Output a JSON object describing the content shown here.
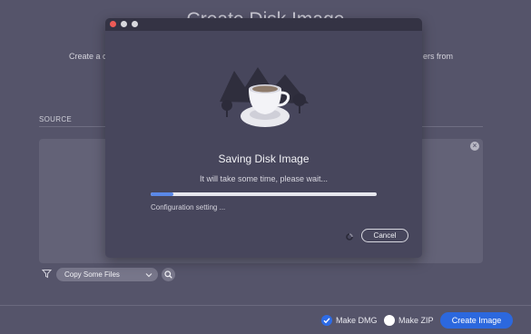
{
  "background": {
    "title": "Create Disk Image",
    "description_left": "Create a c",
    "description_right": "ers from",
    "source_label": "SOURCE",
    "copy_select": {
      "value": "Copy Some Files"
    },
    "options": {
      "make_dmg": {
        "label": "Make DMG",
        "checked": true
      },
      "make_zip": {
        "label": "Make ZIP",
        "checked": false
      }
    },
    "create_button": "Create Image"
  },
  "dialog": {
    "title": "Saving Disk Image",
    "subtitle": "It will take some time, please wait...",
    "status": "Configuration setting ...",
    "progress": 0.1,
    "cancel_button": "Cancel"
  },
  "icons": {
    "filter": "filter-icon",
    "search": "search-icon",
    "chevron": "chevron-down-icon",
    "close": "close-icon",
    "illustration": "coffee-cup-illustration",
    "spinner": "spinner-icon"
  },
  "colors": {
    "accent": "#2c68de",
    "progress": "#5a88e8",
    "window_close": "#ee5b57"
  }
}
